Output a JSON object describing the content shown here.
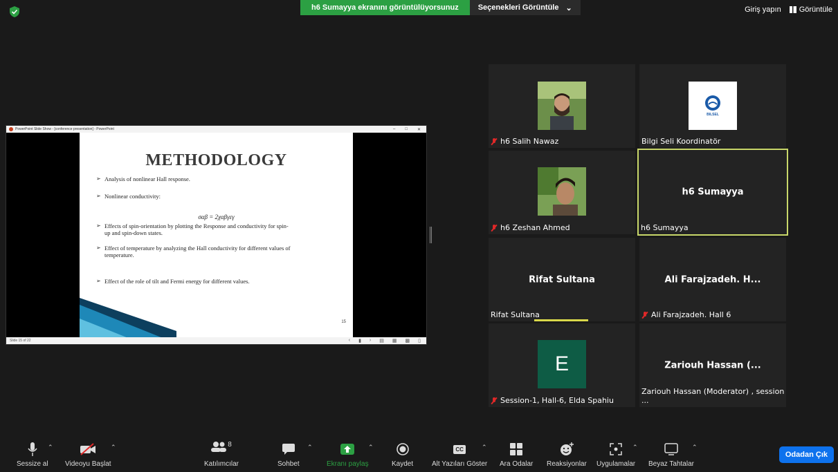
{
  "top": {
    "share_banner": "h6 Sumayya ekranını görüntülüyorsunuz",
    "view_options": "Seçenekleri Görüntüle",
    "signin": "Giriş yapın",
    "view": "Görüntüle"
  },
  "slide": {
    "window_title": "PowerPoint Slide Show - [conference presentation] - PowerPoint",
    "title": "METHODOLOGY",
    "bullets": [
      "Analysis of nonlinear Hall response.",
      "Nonlinear conductivity:",
      "Effects of spin-orientation by plotting the Response and conductivity for spin-up and spin-down states.",
      "Effect of temperature by analyzing the Hall conductivity for different values of temperature.",
      "Effect of the role of tilt and Fermi energy for different values."
    ],
    "formula": "σαβ = 2χαβγεγ",
    "page_number": "15",
    "status": "Slide 15 of 22"
  },
  "participants": [
    {
      "name": "h6 Salih Nawaz",
      "muted": true
    },
    {
      "name": "Bilgi Seli  Koordinatör",
      "muted": false,
      "logo_text": "BILSEL"
    },
    {
      "name": "h6 Zeshan Ahmed",
      "muted": true
    },
    {
      "name": "h6 Sumayya",
      "big": "h6 Sumayya",
      "muted": false
    },
    {
      "name": "Rifat Sultana",
      "big": "Rifat Sultana",
      "muted": false
    },
    {
      "name": "Ali Farajzadeh. Hall 6",
      "big": "Ali Farajzadeh. H...",
      "muted": true
    },
    {
      "name": "Session-1, Hall-6, Elda Spahiu",
      "avatar_letter": "E",
      "muted": true
    },
    {
      "name": "Zariouh Hassan (Moderator) , session ...",
      "big": "Zariouh Hassan (...",
      "muted": false
    }
  ],
  "toolbar": {
    "mute": "Sessize al",
    "video": "Videoyu Başlat",
    "participants": "Katılımcılar",
    "participants_count": "8",
    "chat": "Sohbet",
    "share": "Ekranı paylaş",
    "record": "Kaydet",
    "captions": "Alt Yazıları Göster",
    "captions_icon": "CC",
    "breakout": "Ara Odalar",
    "reactions": "Reaksiyonlar",
    "apps": "Uygulamalar",
    "whiteboard": "Beyaz Tahtalar",
    "leave": "Odadan Çık"
  },
  "colors": {
    "share_green": "#2ca043",
    "leave_blue": "#0e72ed",
    "active_border": "#c9d86a",
    "muted_red": "#e02828"
  }
}
